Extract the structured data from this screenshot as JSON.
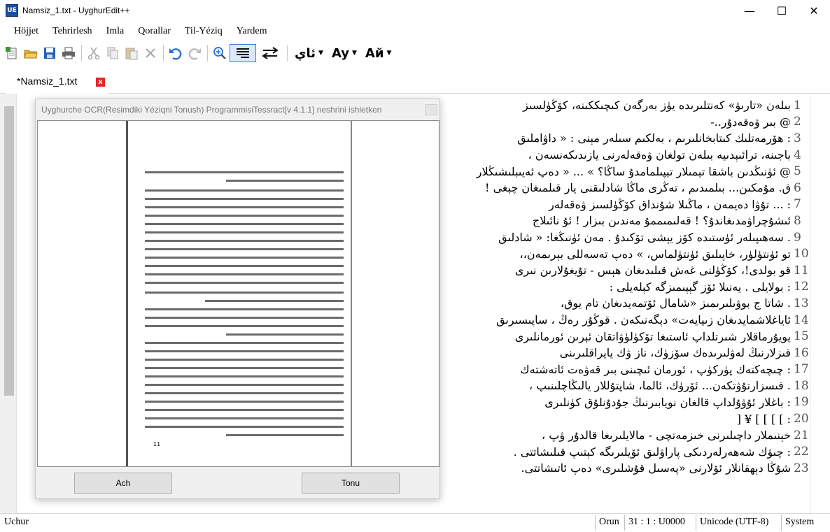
{
  "window": {
    "title": "Namsiz_1.txt - UyghurEdit++",
    "icon_text": "UE",
    "controls": {
      "minimize": "—",
      "maximize": "☐",
      "close": "✕"
    }
  },
  "menu": [
    "Höjjet",
    "Tehrirlesh",
    "Imla",
    "Qorallar",
    "Til-Yéziq",
    "Yardem"
  ],
  "toolbar": {
    "icons": [
      "new-file-icon",
      "open-folder-icon",
      "save-icon",
      "print-icon",
      "cut-icon",
      "copy-icon",
      "paste-icon",
      "delete-icon",
      "undo-icon",
      "redo-icon",
      "zoom-icon",
      "word-wrap-icon",
      "direction-icon"
    ],
    "script_label": "ئاي",
    "font_label": "Ay",
    "case_label": "Aй"
  },
  "tab": {
    "label": "*Namsiz_1.txt",
    "close": "x"
  },
  "editor": {
    "lines": [
      {
        "num": "1",
        "text": "بىلەن «تارىۋ» كەنتلىرىدە يۈز بەرگەن كىچىككىنە، كۆڭۈلسىز"
      },
      {
        "num": "2",
        "text": "@ بىر ۋەقەدۇر..-"
      },
      {
        "num": "3",
        "text": ": ھۆرمەتلىك كىتابخانلىرىم ، بەلكىم سىلەر مېنى : « داۋاملىق"
      },
      {
        "num": "4",
        "text": "باجىنە، ترائىېدىيە بىلەن تولغان ۋەقەلەرنى يازىدىكەنسەن ،"
      },
      {
        "num": "5",
        "text": "@ ئۈنىڭدىن باشقا تېمىلار تېپىلمامدۇ ساڭا؟ » ... « دەپ ئەيىبلىشىڭلار"
      },
      {
        "num": "6",
        "text": "ق. مۇمكىن... بىلمىدىم ، تەڭرى ماڭا شادلىقنى يار قىلمىغان چېغى !"
      },
      {
        "num": "7",
        "text": ": ... تۇۋا دەيمەن ، ماڭىلا شۇنداق كۆڭۈلسىز ۋەقەلەر"
      },
      {
        "num": "8",
        "text": "ئىشۇچراۋمدىغاندۇ؟ ! قەلىمىممۇ مەندىن بىزار ! ئۇ نائىلاج"
      },
      {
        "num": "9",
        "text": ". سەھىپىلەر ئۈستىدە كۆز يېشى تۆكىدۇ . مەن ئۈنىڭغا: « شادلىق"
      },
      {
        "num": "10",
        "text": "تو ئۈنتۈلۈر، خاپىلىق ئۈنتۈلماس، » دەپ تەسەللى بېرىمەن،،"
      },
      {
        "num": "11",
        "text": "قو بولدى!، كۆڭۈلنى غەش قىلىدىغان ھېس - تۇيغۇلارىن نىرى"
      },
      {
        "num": "12",
        "text": ": بولايلى . يەنىلا ئۆز گېپىمىزگە كېلەيلى :"
      },
      {
        "num": "13",
        "text": ". شاتا ج بوۋىلىرىمىز «شامال ئۆتمەيدىغان تام يوق،"
      },
      {
        "num": "14",
        "text": "ئاياغلاشمايدىغان زىيايەت» دېگەنىكەن . قوڭۇر رەڭ ، ساپىسىرىق"
      },
      {
        "num": "15",
        "text": "يويۇرماقلار شىرتلداپ ئاستىغا تۆكۈلۈۋاتقان ئېرىن ئورمانلىرى"
      },
      {
        "num": "16",
        "text": "قىزلارنىڭ لەۋلىرىدەك سۆزۈك، ناز ۋك يايراقلىرىنى"
      },
      {
        "num": "17",
        "text": ": چىچەكتەك پۈركۈپ ، ئورمان ئىچىنى بىر قەۋەت ئاتەشتەك"
      },
      {
        "num": "18",
        "text": ". فىسزارتۇۋتكەن... ئۆرۈك، ئالما، شاپتۇللار يالىڭاچلىنىپ ،"
      },
      {
        "num": "19",
        "text": ": باغلار ئۇۋۇلداپ قالغان نويابىرنىڭ جۇدۇنلۇق كۈنلىرى"
      },
      {
        "num": "20",
        "text": ": ] ] ] ] ¥ ["
      },
      {
        "num": "21",
        "text": "خېنىملار داچىلىرنى خىزمەتچى - مالايلىرىغا قالدۇر ۋپ ،"
      },
      {
        "num": "22",
        "text": ": چىۋك شەھەرلەردىكى پاراۋلىق ئۆيلىرىگە كېتىپ قىلىشاتتى ."
      },
      {
        "num": "23",
        "text": "شۇڭا دېھقانلار ئۆلارنى «پەسىل قۇشلىرى» دەپ ئاتىشاتتى."
      }
    ]
  },
  "ocr_dialog": {
    "title": "Uyghurche OCR(Resimdiki Yéziqni Tonush) ProgrammisiTessract[v 4.1.1] neshrini ishletken",
    "page_number": "11",
    "open_button": "Ach",
    "recognize_button": "Tonu"
  },
  "statusbar": {
    "script": "Uchur",
    "position_label": "Orun",
    "position": "31 : 1 : U0000",
    "encoding": "Unicode (UTF-8)",
    "line_ending": "System"
  }
}
